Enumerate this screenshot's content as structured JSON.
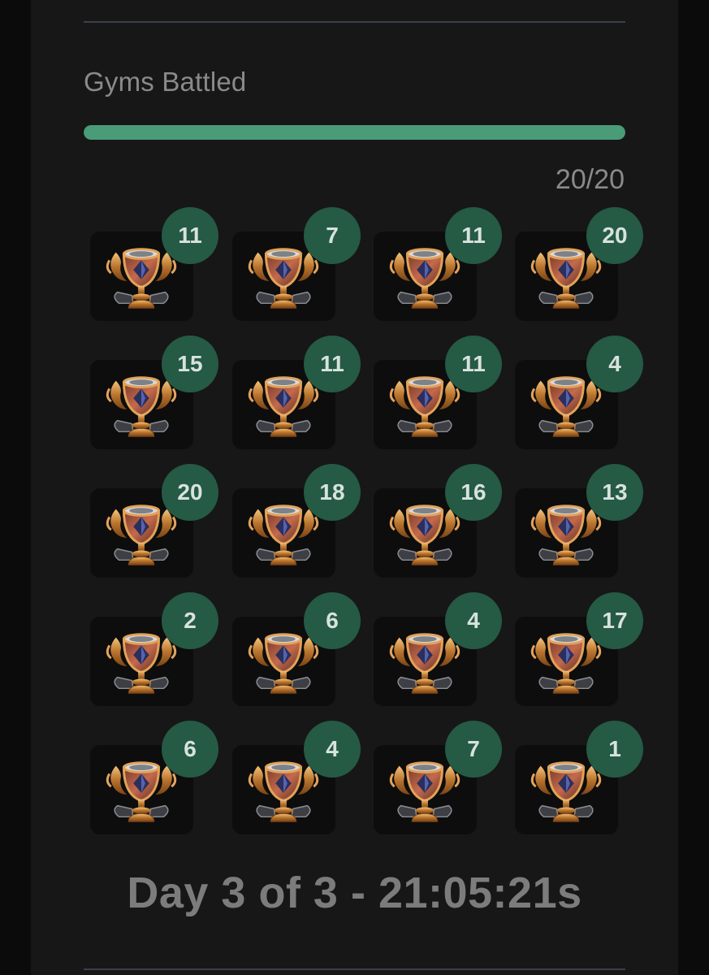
{
  "section": {
    "title": "Gyms Battled",
    "progress_fraction": 1.0,
    "count_label": "20/20"
  },
  "colors": {
    "progress": "#4a9b78",
    "badge": "#255a45",
    "tile": "#0d0d0d",
    "panel": "#171717"
  },
  "gyms": [
    {
      "icon": "trophy-icon",
      "battles": "11"
    },
    {
      "icon": "trophy-icon",
      "battles": "7"
    },
    {
      "icon": "trophy-icon",
      "battles": "11"
    },
    {
      "icon": "trophy-icon",
      "battles": "20"
    },
    {
      "icon": "trophy-icon",
      "battles": "15"
    },
    {
      "icon": "trophy-icon",
      "battles": "11"
    },
    {
      "icon": "trophy-icon",
      "battles": "11"
    },
    {
      "icon": "trophy-icon",
      "battles": "4"
    },
    {
      "icon": "trophy-icon",
      "battles": "20"
    },
    {
      "icon": "trophy-icon",
      "battles": "18"
    },
    {
      "icon": "trophy-icon",
      "battles": "16"
    },
    {
      "icon": "trophy-icon",
      "battles": "13"
    },
    {
      "icon": "trophy-icon",
      "battles": "2"
    },
    {
      "icon": "trophy-icon",
      "battles": "6"
    },
    {
      "icon": "trophy-icon",
      "battles": "4"
    },
    {
      "icon": "trophy-icon",
      "battles": "17"
    },
    {
      "icon": "trophy-icon",
      "battles": "6"
    },
    {
      "icon": "trophy-icon",
      "battles": "4"
    },
    {
      "icon": "trophy-icon",
      "battles": "7"
    },
    {
      "icon": "trophy-icon",
      "battles": "1"
    }
  ],
  "timer": {
    "text": "Day 3 of 3 - 21:05:21s"
  }
}
